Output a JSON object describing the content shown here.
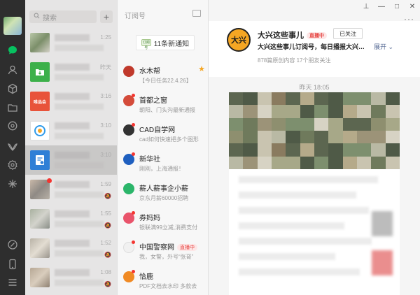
{
  "window": {
    "controls": [
      "⊥",
      "—",
      "□",
      "✕"
    ],
    "more": "···"
  },
  "rail": {
    "icons": [
      "chat-icon",
      "contacts-icon",
      "favorites-icon",
      "files-icon",
      "moments-icon",
      "channels-icon",
      "search-icon",
      "miniprogram-icon",
      "link-icon",
      "phone-icon",
      "menu-icon"
    ],
    "active_color": "#07c160"
  },
  "search": {
    "placeholder": "搜索",
    "plus": "+"
  },
  "chats": [
    {
      "time": "1:25"
    },
    {
      "time": "昨天"
    },
    {
      "time": "3:16"
    },
    {
      "time": "3:10"
    },
    {
      "time": "3:10"
    },
    {
      "time": "1:59"
    },
    {
      "time": "1:55"
    },
    {
      "time": "1:52"
    },
    {
      "time": "1:08"
    }
  ],
  "subscriptions": {
    "header": "订阅号",
    "notify": {
      "logo_text": "订阅号",
      "text": "11条新通知"
    },
    "items": [
      {
        "name": "水木帮",
        "desc": "【今日任务22.4.26】",
        "starred": true,
        "dot": true
      },
      {
        "name": "首都之窗",
        "desc": "朝阳、门头沟最新通报",
        "dot": true
      },
      {
        "name": "CAD自学网",
        "desc": "cad如何快速把多个图形",
        "dot": true
      },
      {
        "name": "新华社",
        "desc": "刚刚，上海通报！",
        "dot": true
      },
      {
        "name": "薪人薪事企小薪",
        "desc": "京东月薪60000招聘",
        "dot": false
      },
      {
        "name": "券妈妈",
        "desc": "银联满99立减,消费支付",
        "dot": true
      },
      {
        "name": "中国警察网",
        "desc": "我，女警，外号“张哥”",
        "live": "直播中",
        "dot": true
      },
      {
        "name": "恰鹿",
        "desc": "PDF文档去水印 多款去",
        "dot": true
      }
    ]
  },
  "article": {
    "account_name": "大兴这些事儿",
    "live": "直播中",
    "follow": "已关注",
    "description": "大兴这些事儿订阅号，每日播报大兴…",
    "expand": "展开",
    "stats": "878篇原创内容  17个朋友关注",
    "logo_text": "大兴",
    "time": "昨天  18:05"
  }
}
